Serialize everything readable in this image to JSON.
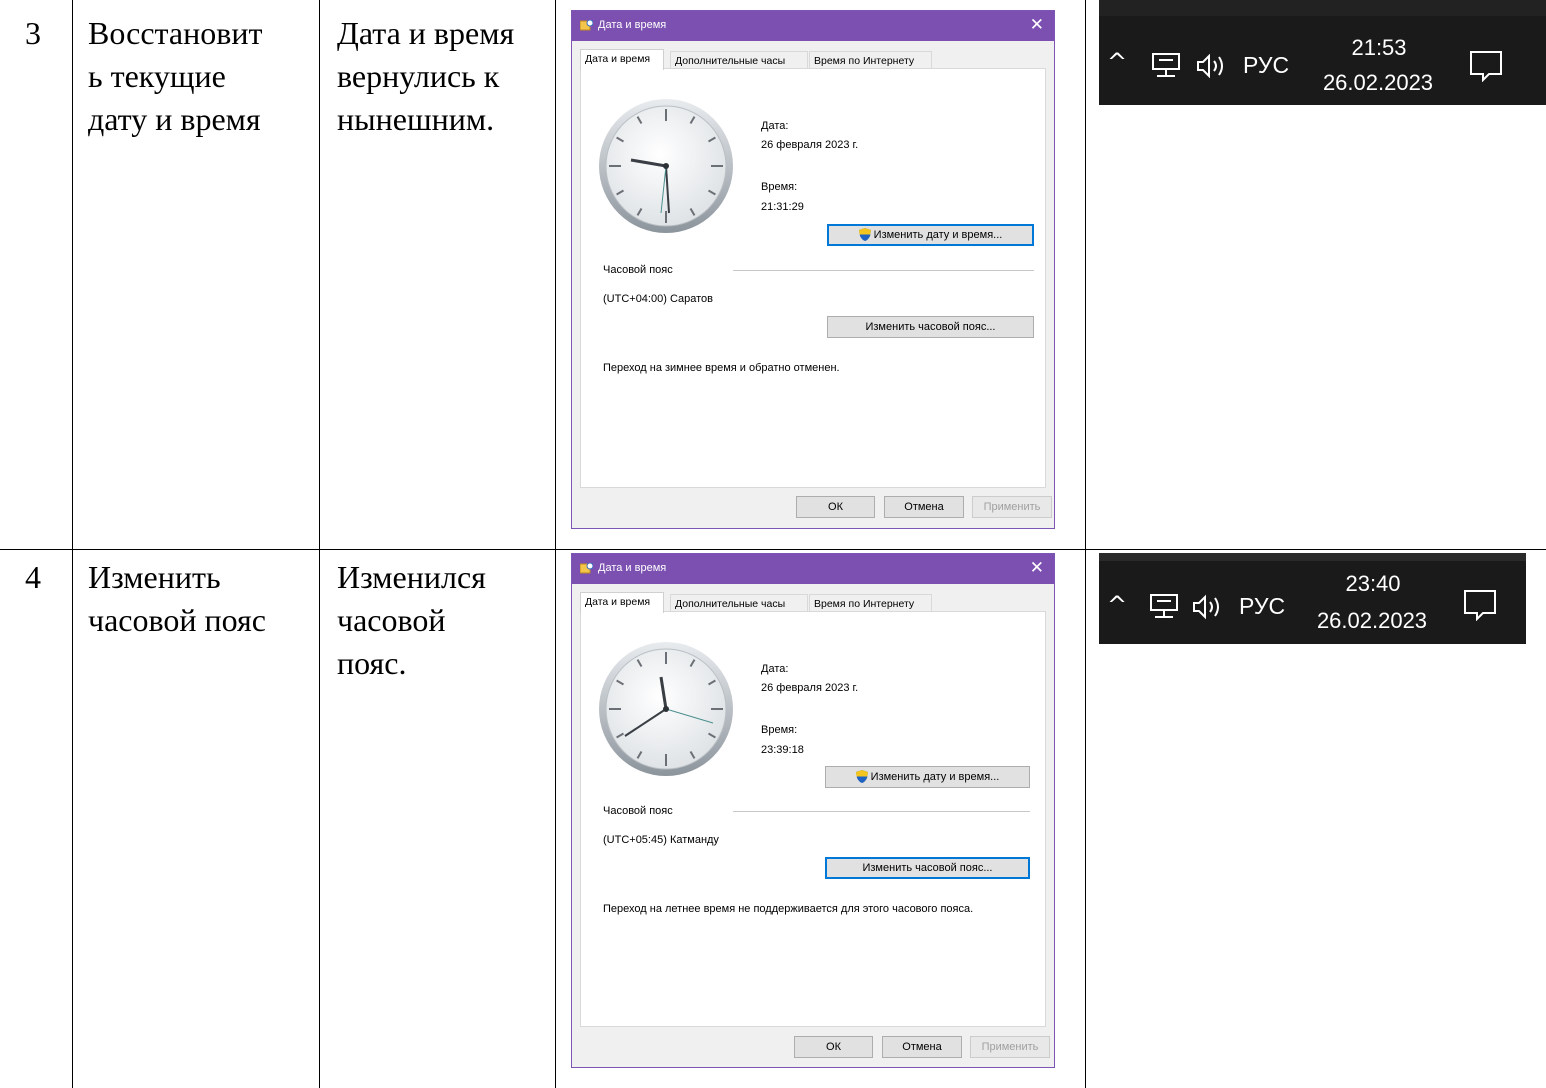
{
  "rows": [
    {
      "number": "3",
      "action": "Восстановит\nь текущие\nдату и время",
      "result": "Дата и время\nвернулись к\nнынешним.",
      "dialog": {
        "title": "Дата и время",
        "tabs": [
          "Дата и время",
          "Дополнительные часы",
          "Время по Интернету"
        ],
        "date_label": "Дата:",
        "date_value": "26 февраля 2023 г.",
        "time_label": "Время:",
        "time_value": "21:31:29",
        "change_datetime_button": "Изменить дату и время...",
        "timezone_label": "Часовой пояс",
        "timezone_value": "(UTC+04:00) Саратов",
        "change_timezone_button": "Изменить часовой пояс...",
        "dst_note": "Переход на зимнее время и обратно отменен.",
        "ok": "ОК",
        "cancel": "Отмена",
        "apply": "Применить"
      },
      "tray": {
        "lang": "РУС",
        "time": "21:53",
        "date": "26.02.2023"
      }
    },
    {
      "number": "4",
      "action": "Изменить\nчасовой пояс",
      "result": "Изменился\nчасовой\nпояс.",
      "dialog": {
        "title": "Дата и время",
        "tabs": [
          "Дата и время",
          "Дополнительные часы",
          "Время по Интернету"
        ],
        "date_label": "Дата:",
        "date_value": "26 февраля 2023 г.",
        "time_label": "Время:",
        "time_value": "23:39:18",
        "change_datetime_button": "Изменить дату и время...",
        "timezone_label": "Часовой пояс",
        "timezone_value": "(UTC+05:45) Катманду",
        "change_timezone_button": "Изменить часовой пояс...",
        "dst_note": "Переход на летнее время не поддерживается для этого часового пояса.",
        "ok": "ОК",
        "cancel": "Отмена",
        "apply": "Применить"
      },
      "tray": {
        "lang": "РУС",
        "time": "23:40",
        "date": "26.02.2023"
      }
    }
  ],
  "colors": {
    "titlebar": "#7b50b0",
    "focus_border": "#0078d7",
    "tray_bg": "#1a1a1a"
  },
  "icons": [
    "app-icon",
    "close-icon",
    "clock-icon",
    "uac-shield-icon",
    "chevron-up-icon",
    "network-icon",
    "volume-icon",
    "notification-icon"
  ]
}
